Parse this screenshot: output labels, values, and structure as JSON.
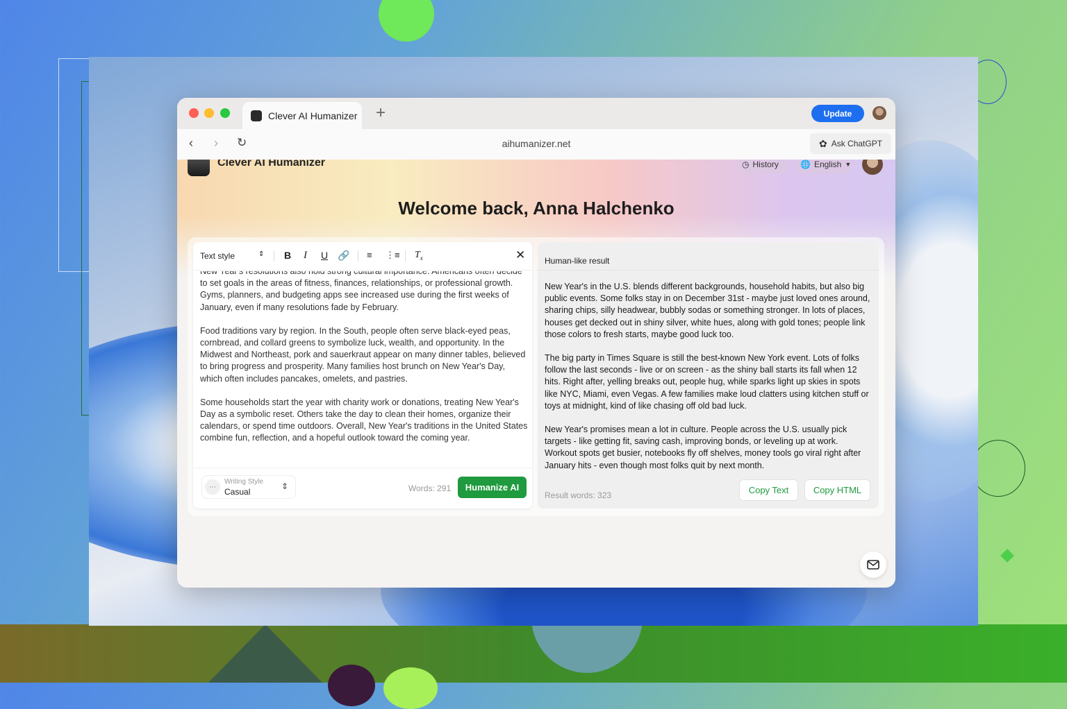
{
  "browser": {
    "tab_title": "Clever AI Humanizer",
    "new_tab_icon": "plus-icon",
    "update_label": "Update",
    "url": "aihumanizer.net",
    "ask_label": "Ask ChatGPT"
  },
  "app": {
    "name": "Clever AI Humanizer",
    "history_label": "History",
    "language_label": "English",
    "welcome": "Welcome back, Anna Halchenko"
  },
  "editor": {
    "text_style_label": "Text style",
    "paragraphs": [
      "New Year's resolutions also hold strong cultural importance. Americans often decide to set goals in the areas of fitness, finances, relationships, or professional growth. Gyms, planners, and budgeting apps see increased use during the first weeks of January, even if many resolutions fade by February.",
      "Food traditions vary by region. In the South, people often serve black-eyed peas, cornbread, and collard greens to symbolize luck, wealth, and opportunity. In the Midwest and Northeast, pork and sauerkraut appear on many dinner tables, believed to bring progress and prosperity. Many families host brunch on New Year's Day, which often includes pancakes, omelets, and pastries.",
      "Some households start the year with charity work or donations, treating New Year's Day as a symbolic reset. Others take the day to clean their homes, organize their calendars, or spend time outdoors. Overall, New Year's traditions in the United States combine fun, reflection, and a hopeful outlook toward the coming year."
    ],
    "writing_style_label": "Writing Style",
    "writing_style_value": "Casual",
    "words": "Words: 291",
    "humanize_label": "Humanize AI"
  },
  "result": {
    "title": "Human-like result",
    "paragraphs": [
      "New Year's in the U.S. blends different backgrounds, household habits, but also big public events. Some folks stay in on December 31st - maybe just loved ones around, sharing chips, silly headwear, bubbly sodas or something stronger. In lots of places, houses get decked out in shiny silver, white hues, along with gold tones; people link those colors to fresh starts, maybe good luck too.",
      "The big party in Times Square is still the best-known New York event. Lots of folks follow the last seconds - live or on screen - as the shiny ball starts its fall when 12 hits. Right after, yelling breaks out, people hug, while sparks light up skies in spots like NYC, Miami, even Vegas. A few families make loud clatters using kitchen stuff or toys at midnight, kind of like chasing off old bad luck.",
      "New Year's promises mean a lot in culture. People across the U.S. usually pick targets - like getting fit, saving cash, improving bonds, or leveling up at work. Workout spots get busier, notebooks fly off shelves, money tools go viral right after January hits - even though most folks quit by next month."
    ],
    "words": "Result words: 323",
    "copy_text_label": "Copy Text",
    "copy_html_label": "Copy HTML"
  },
  "colors": {
    "accent_green": "#1f9a3e",
    "accent_blue": "#1e6ef0",
    "highlight_blue": "#2a6bd0"
  }
}
